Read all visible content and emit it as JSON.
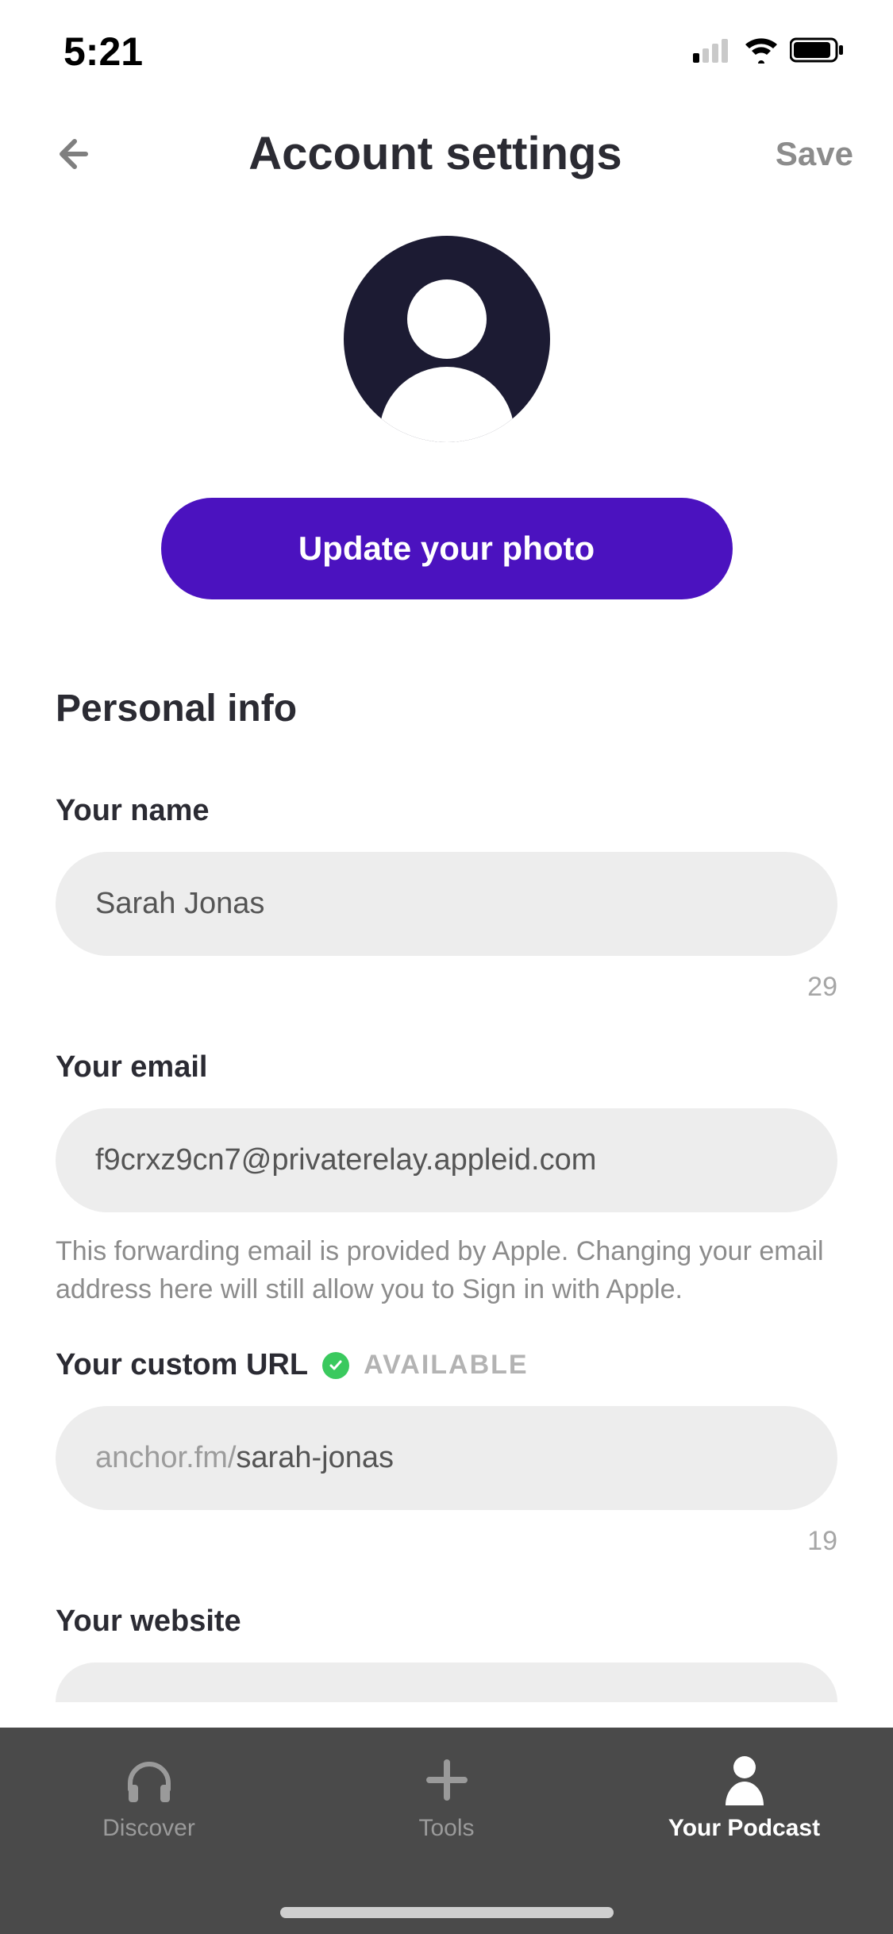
{
  "status": {
    "time": "5:21"
  },
  "header": {
    "title": "Account settings",
    "save": "Save"
  },
  "photo": {
    "update_label": "Update your photo"
  },
  "section": {
    "title": "Personal info"
  },
  "name": {
    "label": "Your name",
    "value": "Sarah Jonas",
    "counter": "29"
  },
  "email": {
    "label": "Your email",
    "value": "f9crxz9cn7@privaterelay.appleid.com",
    "help": "This forwarding email is provided by Apple. Changing your email address here will still allow you to Sign in with Apple."
  },
  "url": {
    "label": "Your custom URL",
    "availability": "AVAILABLE",
    "prefix": "anchor.fm/",
    "value": "sarah-jonas",
    "counter": "19"
  },
  "website": {
    "label": "Your website"
  },
  "tabs": {
    "discover": "Discover",
    "tools": "Tools",
    "yourpodcast": "Your Podcast"
  }
}
